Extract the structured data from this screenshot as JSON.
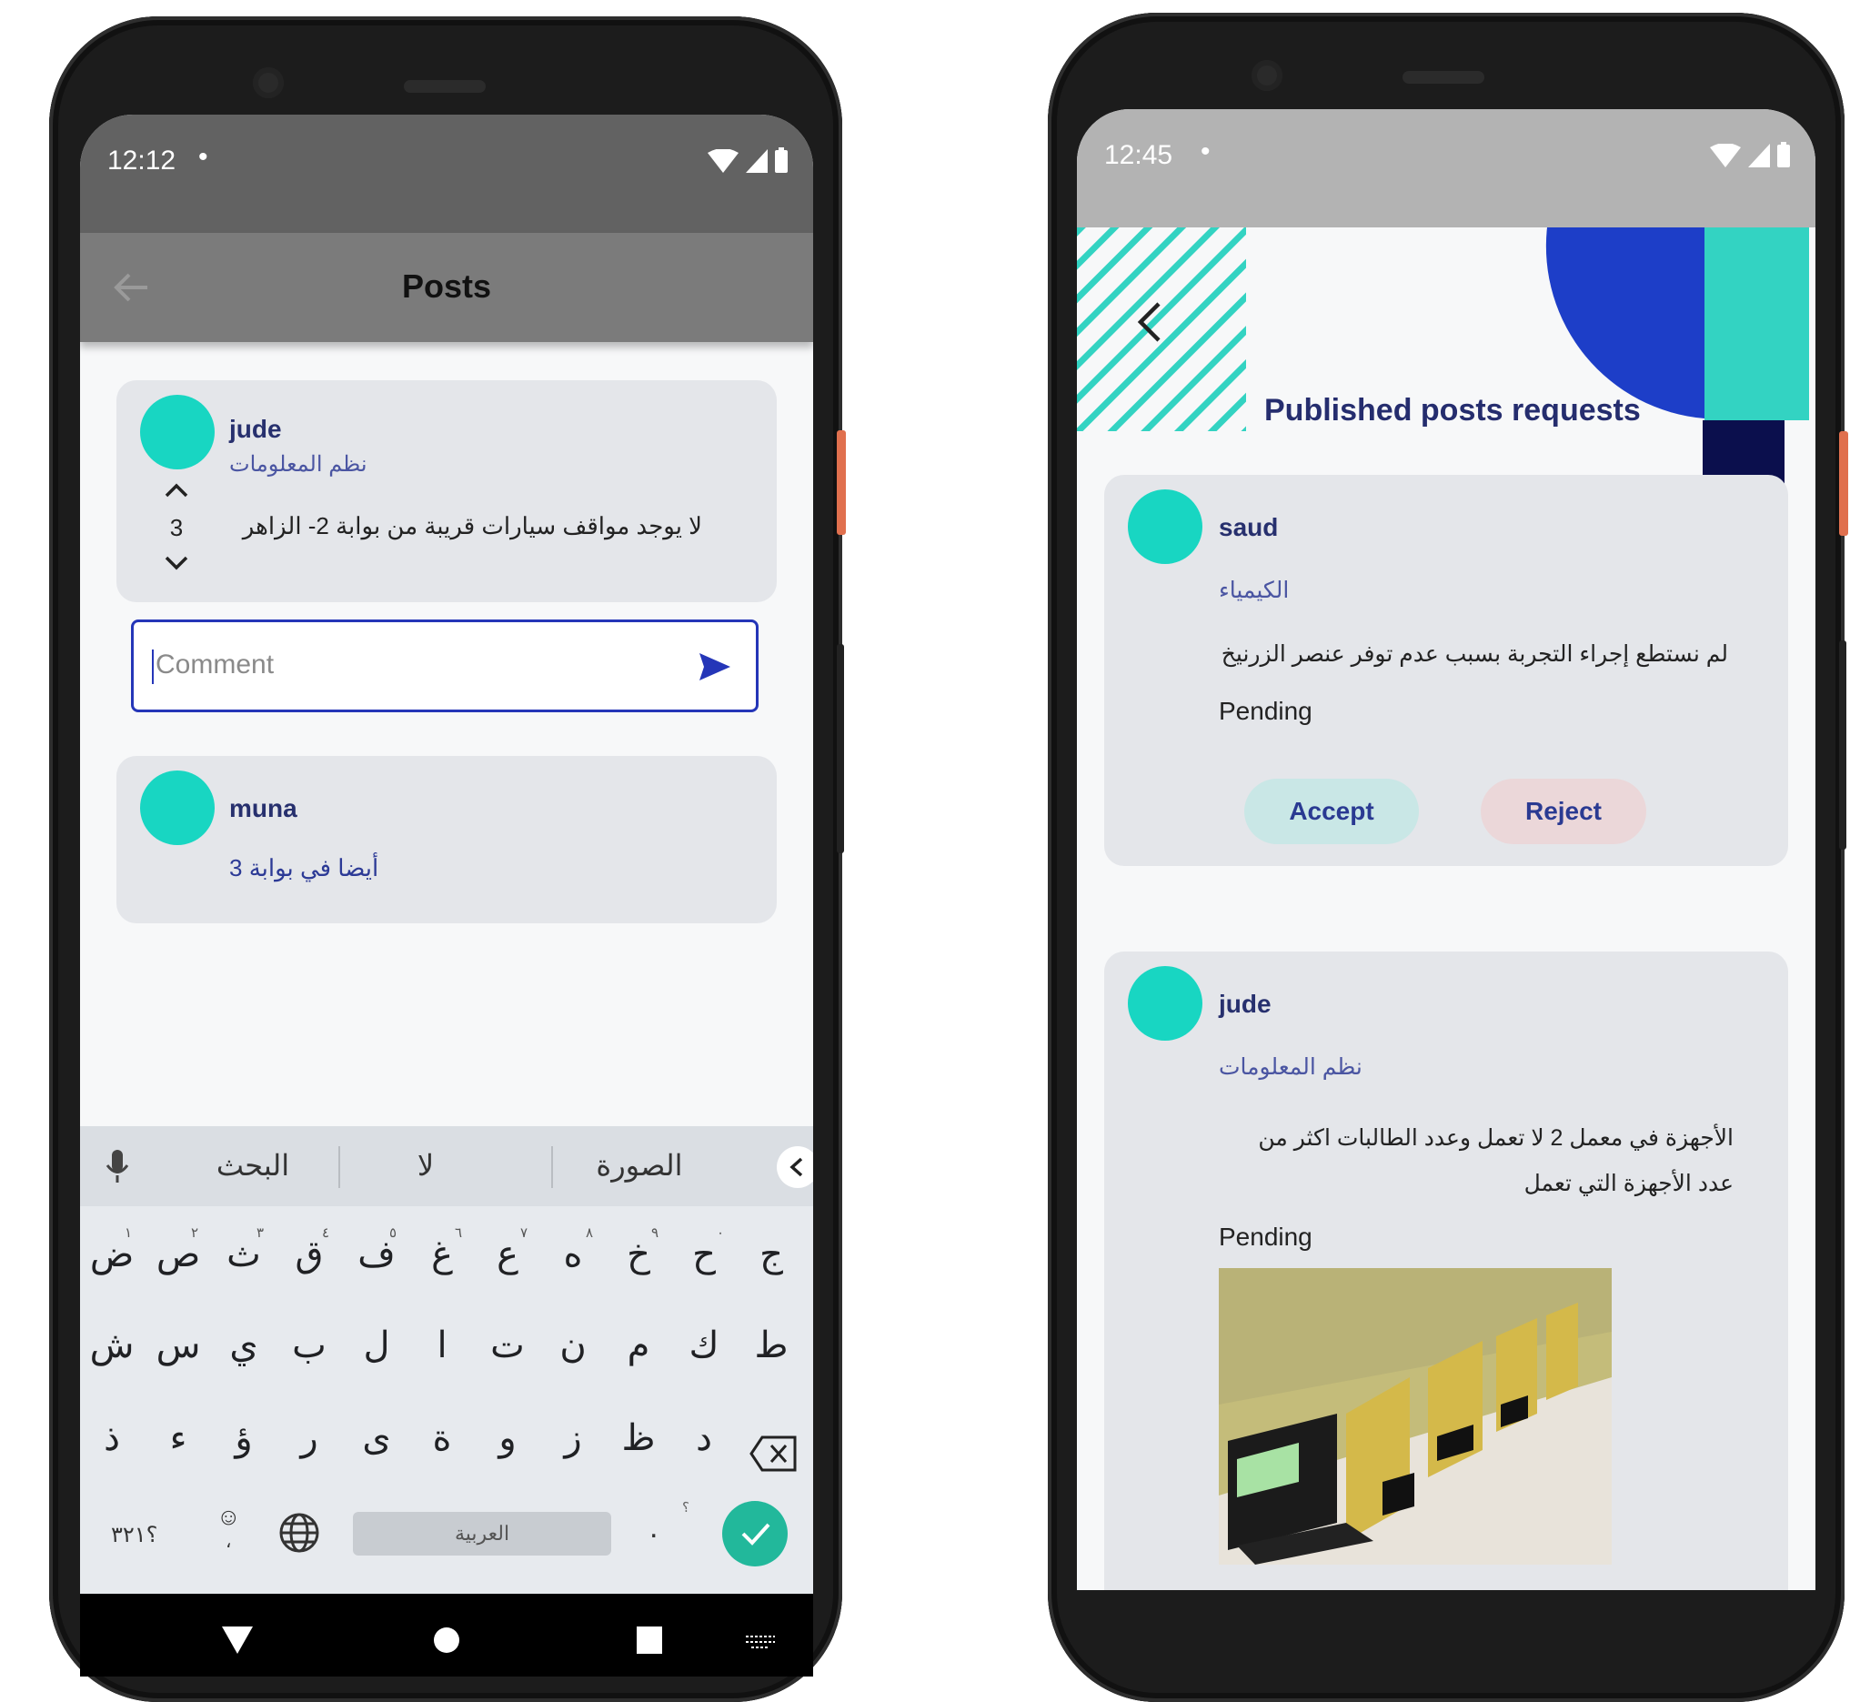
{
  "left_phone": {
    "status_time": "12:12",
    "status_dot": "•",
    "appbar": {
      "title": "Posts",
      "back_icon": "arrow-left-icon"
    },
    "post": {
      "username": "jude",
      "department": "نظم المعلومات",
      "votes": "3",
      "text": "لا يوجد مواقف سيارات قريبة من بوابة 2- الزاهر"
    },
    "comment_input": {
      "placeholder": "Comment",
      "send_icon": "send-icon"
    },
    "comment": {
      "username": "muna",
      "text": "أيضا في بوابة 3"
    },
    "keyboard": {
      "suggestions": [
        "البحث",
        "لا",
        "الصورة"
      ],
      "row1": [
        "ض",
        "ص",
        "ث",
        "ق",
        "ف",
        "غ",
        "ع",
        "ه",
        "خ",
        "ح",
        "ج"
      ],
      "row1_hints": [
        "١",
        "٢",
        "٣",
        "٤",
        "٥",
        "٦",
        "٧",
        "٨",
        "٩",
        "٠",
        ""
      ],
      "row2": [
        "ش",
        "س",
        "ي",
        "ب",
        "ل",
        "ا",
        "ت",
        "ن",
        "م",
        "ك",
        "ط"
      ],
      "row3": [
        "ذ",
        "ء",
        "ؤ",
        "ر",
        "ى",
        "ة",
        "و",
        "ز",
        "ظ",
        "د"
      ],
      "symbols_key": "؟٣٢١",
      "emoji_key": "☺",
      "emoji_hint": "،",
      "space_label": "العربية",
      "period_key": ".",
      "period_hint": "؟"
    }
  },
  "right_phone": {
    "status_time": "12:45",
    "status_dot": "•",
    "header_title": "Published posts requests",
    "colors": {
      "teal": "#33d3c2",
      "blue": "#1d3ec8",
      "navy": "#0b0f4d"
    },
    "request1": {
      "username": "saud",
      "department": "الكيمياء",
      "text": "لم نستطع إجراء التجربة بسبب عدم توفر عنصر الزرنيخ",
      "status": "Pending",
      "accept_label": "Accept",
      "reject_label": "Reject"
    },
    "request2": {
      "username": "jude",
      "department": "نظم المعلومات",
      "text": "الأجهزة في معمل 2 لا تعمل وعدد الطالبات اكثر من عدد الأجهزة التي تعمل",
      "status": "Pending",
      "image": "computer-lab-photo"
    }
  }
}
